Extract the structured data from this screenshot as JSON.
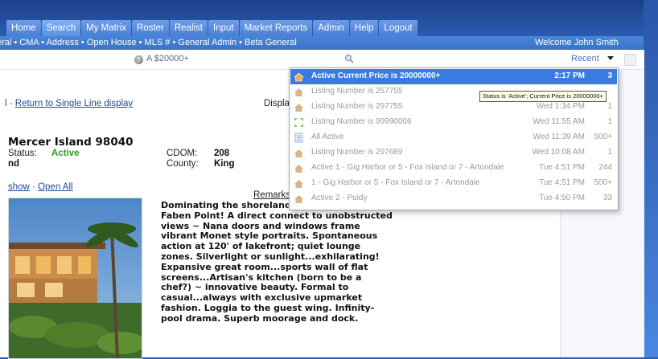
{
  "nav": {
    "tabs": [
      {
        "label": "Home"
      },
      {
        "label": "Search"
      },
      {
        "label": "My Matrix"
      },
      {
        "label": "Roster"
      },
      {
        "label": "Realist"
      },
      {
        "label": "Input"
      },
      {
        "label": "Market Reports"
      },
      {
        "label": "Admin"
      },
      {
        "label": "Help"
      },
      {
        "label": "Logout"
      }
    ],
    "active_tab": "Search"
  },
  "subnav": {
    "links_text": "eral • CMA • Address • Open House • MLS # • General Admin • Beta General",
    "welcome": "Welcome John Smith"
  },
  "toolbar": {
    "help_icon": "?",
    "search_query": "A $20000+",
    "recent_label": "Recent"
  },
  "content": {
    "link_line_prefix": "l · ",
    "return_link": "Return to Single Line display",
    "display_label": "Displa",
    "address": "Mercer Island 98040",
    "status_label": "Status:",
    "status_value": "Active",
    "nd_text": "nd",
    "cdom_label": "CDOM:",
    "cdom_value": "208",
    "county_label": "County:",
    "county_value": "King",
    "slideshow_link": "show",
    "separator": " · ",
    "open_all_link": "Open All",
    "remarks_title": "Remarks",
    "remarks_text": "Dominating the shoreland area on fabled Faben Point! A direct connect to unobstructed views ~ Nana doors and windows frame vibrant Monet style portraits. Spontaneous action at 120' of lakefront; quiet lounge zones. Silverlight or sunlight...exhilarating! Expansive great room...sports wall of flat screens...Artisan's kitchen (born to be a chef?) ~ innovative beauty. Formal to casual...always with exclusive upmarket fashion. Loggia to the guest wing. Infinity-pool drama. Superb moorage and dock."
  },
  "recent_dropdown": {
    "items": [
      {
        "icon": "house-icon",
        "text": "Active Current Price is 20000000+",
        "time": "2:17 PM",
        "count": "3",
        "active": true
      },
      {
        "icon": "house-icon",
        "text": "Listing Number is 257755",
        "time": "",
        "count": "",
        "active": false
      },
      {
        "icon": "house-icon",
        "text": "Listing Number is 297755",
        "time": "Wed 1:34 PM",
        "count": "1",
        "active": false
      },
      {
        "icon": "arrows-icon",
        "text": "Listing Number is 99990006",
        "time": "Wed 11:55 AM",
        "count": "1",
        "active": false
      },
      {
        "icon": "document-icon",
        "text": "All Active",
        "time": "Wed 11:39 AM",
        "count": "500+",
        "active": false
      },
      {
        "icon": "house-icon",
        "text": "Listing Number is 297689",
        "time": "Wed 10:08 AM",
        "count": "1",
        "active": false
      },
      {
        "icon": "house-icon",
        "text": "Active 1 - Gig Harbor or 5 - Fox Island or 7 - Artondale",
        "time": "Tue 4:51 PM",
        "count": "244",
        "active": false
      },
      {
        "icon": "house-icon",
        "text": "1 - Gig Harbor or 5 - Fox Island or 7 - Artondale",
        "time": "Tue 4:51 PM",
        "count": "500+",
        "active": false
      },
      {
        "icon": "house-icon",
        "text": "Active 2 - Puidy",
        "time": "Tue 4:50 PM",
        "count": "33",
        "active": false
      }
    ],
    "tooltip": "Status is 'Active'; Current Price is 20000000+"
  },
  "colors": {
    "accent_blue": "#3a7be0",
    "status_green": "#2f9a23",
    "link_blue": "#1e4a96"
  }
}
